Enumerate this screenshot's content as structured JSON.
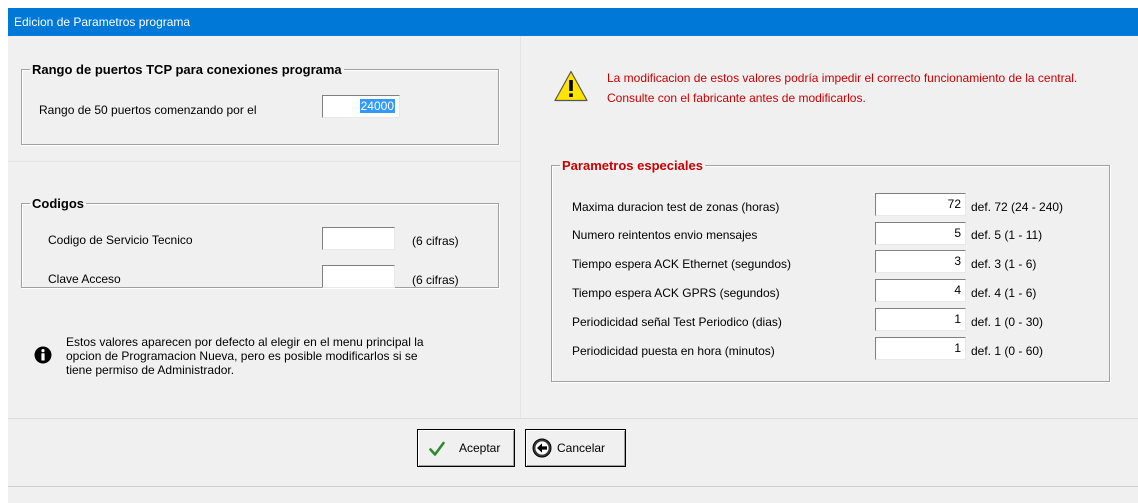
{
  "window": {
    "title": "Edicion de Parametros programa"
  },
  "tcp_group": {
    "legend": "Rango de puertos TCP para conexiones programa",
    "label": "Rango de 50 puertos comenzando por el",
    "value": "24000"
  },
  "codigos_group": {
    "legend": "Codigos",
    "rows": [
      {
        "label": "Codigo de Servicio Tecnico",
        "value": "",
        "hint": "(6 cifras)"
      },
      {
        "label": "Clave Acceso",
        "value": "",
        "hint": "(6 cifras)"
      }
    ]
  },
  "info": {
    "icon": "info-icon",
    "text": "Estos valores aparecen por defecto al elegir en el menu principal la opcion de Programacion Nueva, pero es posible modificarlos si se tiene permiso de Administrador."
  },
  "warning": {
    "icon": "warning-icon",
    "line1": "La modificacion de estos valores podría impedir el correcto funcionamiento de la central.",
    "line2": "Consulte con el fabricante antes de modificarlos.",
    "color": "#cc0000"
  },
  "especiales_group": {
    "legend": "Parametros especiales",
    "legend_color": "#cc0000",
    "rows": [
      {
        "label": "Maxima duracion test de zonas (horas)",
        "value": "72",
        "hint": "def. 72  (24 - 240)"
      },
      {
        "label": "Numero reintentos envio mensajes",
        "value": "5",
        "hint": "def. 5  (1 - 11)"
      },
      {
        "label": "Tiempo espera ACK Ethernet (segundos)",
        "value": "3",
        "hint": "def. 3  (1 - 6)"
      },
      {
        "label": "Tiempo espera ACK GPRS  (segundos)",
        "value": "4",
        "hint": "def. 4  (1 - 6)"
      },
      {
        "label": "Periodicidad señal Test Periodico (dias)",
        "value": "1",
        "hint": "def. 1  (0 - 30)"
      },
      {
        "label": "Periodicidad puesta en hora (minutos)",
        "value": "1",
        "hint": "def. 1  (0 - 60)"
      }
    ]
  },
  "buttons": {
    "accept_label": "Aceptar",
    "accept_icon": "checkmark-icon",
    "cancel_label": "Cancelar",
    "cancel_icon": "back-arrow-icon"
  },
  "colors": {
    "titlebar": "#0078d7",
    "selection": "#3399ff",
    "check": "#2e8b2e"
  }
}
